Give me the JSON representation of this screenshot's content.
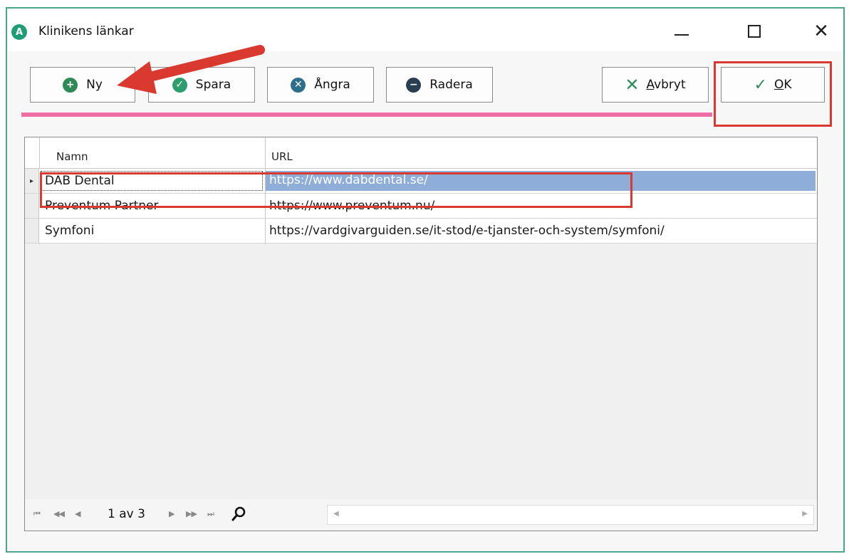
{
  "window": {
    "icon_letter": "A",
    "title": "Klinikens länkar",
    "minimize_icon": "minimize-icon",
    "maximize_icon": "maximize-icon",
    "close_glyph": "✕"
  },
  "toolbar": {
    "new_label": "Ny",
    "save_label": "Spara",
    "undo_label": "Ångra",
    "delete_label": "Radera",
    "cancel_label": "Avbryt",
    "ok_label": "OK"
  },
  "table": {
    "columns": [
      "Namn",
      "URL"
    ],
    "rows": [
      {
        "name": "DAB Dental",
        "url": "https://www.dabdental.se/",
        "selected": true
      },
      {
        "name": "Preventum Partner",
        "url": "https://www.preventum.nu/"
      },
      {
        "name": "Symfoni",
        "url": "https://vardgivarguiden.se/it-stod/e-tjanster-och-system/symfoni/"
      }
    ],
    "current_row_marker": "▸"
  },
  "navigator": {
    "page_text": "1 av 3",
    "first": "⏮",
    "prev_page": "◀◀",
    "prev": "◀",
    "next": "▶",
    "next_page": "▶▶",
    "last": "⏭"
  },
  "colors": {
    "accent_green": "#2e8b57",
    "selection": "#8eaed9",
    "divider_pink": "#ee6fa6",
    "annotation_red": "#d9392f"
  }
}
